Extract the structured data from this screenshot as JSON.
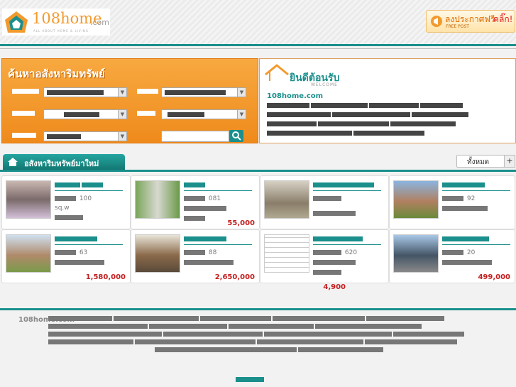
{
  "header": {
    "logo_text": "108home",
    "logo_suffix": ".com",
    "logo_tagline": "ALL ABOUT HOME & LIVING",
    "free_post_title": "ลงประกาศฟรี",
    "free_post_click": "คลิ๊ก!",
    "free_post_sub": "FREE POST"
  },
  "search": {
    "title": "ค้นหาอสังหาริมทรัพย์"
  },
  "welcome": {
    "title": "ยินดีต้อนรับ",
    "sub": "WELCOME",
    "site": "108home.com"
  },
  "new_listings": {
    "tab_label": "อสังหาริมทรัพย์มาใหม่",
    "all_button": "ทั้งหมด",
    "plus_button": "+"
  },
  "cards": [
    {
      "size": "100",
      "unit": "sq.w",
      "price": ""
    },
    {
      "size": "081",
      "unit": "",
      "price": "55,000"
    },
    {
      "size": "",
      "unit": "",
      "price": ""
    },
    {
      "size": "92",
      "unit": "",
      "price": ""
    },
    {
      "size": "63",
      "unit": "",
      "price": "1,580,000"
    },
    {
      "size": "88",
      "unit": "",
      "price": "2,650,000"
    },
    {
      "size": "620",
      "unit": "",
      "price": "4,900"
    },
    {
      "size": "20",
      "unit": "",
      "price": "499,000"
    }
  ],
  "footer": {
    "site": "108home.com"
  },
  "colors": {
    "orange": "#f29a2e",
    "teal": "#1a8f8c",
    "price": "#c41e1e"
  }
}
